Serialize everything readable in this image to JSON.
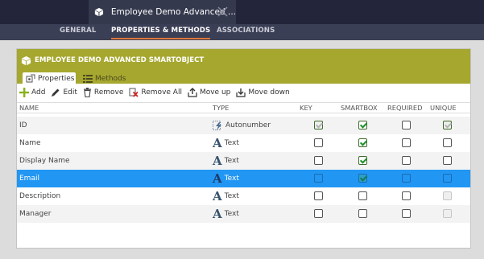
{
  "window": {
    "tab_title": "Employee Demo Advanced ...",
    "tab_icon": "cube-icon",
    "close_icon": "close-icon"
  },
  "nav": {
    "tabs": [
      {
        "label": "GENERAL",
        "active": false
      },
      {
        "label": "PROPERTIES & METHODS",
        "active": true
      },
      {
        "label": "ASSOCIATIONS",
        "active": false
      }
    ]
  },
  "panel": {
    "title": "EMPLOYEE DEMO ADVANCED SMARTOBJECT",
    "subtabs": [
      {
        "label": "Properties",
        "icon": "properties-icon",
        "active": true
      },
      {
        "label": "Methods",
        "icon": "methods-icon",
        "active": false
      }
    ],
    "toolbar": [
      {
        "label": "Add",
        "icon": "plus-icon"
      },
      {
        "label": "Edit",
        "icon": "pencil-icon"
      },
      {
        "label": "Remove",
        "icon": "trash-icon"
      },
      {
        "label": "Remove All",
        "icon": "remove-all-icon"
      },
      {
        "label": "Move up",
        "icon": "move-up-icon"
      },
      {
        "label": "Move down",
        "icon": "move-down-icon"
      }
    ],
    "columns": [
      "NAME",
      "TYPE",
      "KEY",
      "SMARTBOX",
      "REQUIRED",
      "UNIQUE"
    ],
    "rows": [
      {
        "name": "ID",
        "type": "Autonumber",
        "type_icon": "autonumber-icon",
        "key": true,
        "smartbox": true,
        "required": false,
        "unique": true,
        "key_disabled": true,
        "unique_disabled": true,
        "selected": false
      },
      {
        "name": "Name",
        "type": "Text",
        "type_icon": "text-type-icon",
        "key": false,
        "smartbox": true,
        "required": false,
        "unique": false,
        "key_disabled": false,
        "unique_disabled": false,
        "selected": false
      },
      {
        "name": "Display Name",
        "type": "Text",
        "type_icon": "text-type-icon",
        "key": false,
        "smartbox": true,
        "required": false,
        "unique": false,
        "key_disabled": false,
        "unique_disabled": false,
        "selected": false
      },
      {
        "name": "Email",
        "type": "Text",
        "type_icon": "text-type-icon",
        "key": false,
        "smartbox": true,
        "required": false,
        "unique": false,
        "key_disabled": false,
        "unique_disabled": false,
        "selected": true
      },
      {
        "name": "Description",
        "type": "Text",
        "type_icon": "text-type-icon",
        "key": false,
        "smartbox": false,
        "required": false,
        "unique": false,
        "key_disabled": false,
        "unique_disabled": true,
        "selected": false
      },
      {
        "name": "Manager",
        "type": "Text",
        "type_icon": "text-type-icon",
        "key": false,
        "smartbox": false,
        "required": false,
        "unique": false,
        "key_disabled": false,
        "unique_disabled": true,
        "selected": false
      }
    ]
  },
  "colors": {
    "topbar": "#23263a",
    "navbar": "#3b3f55",
    "accent": "#e0773a",
    "panel_header": "#a6a72f",
    "selected_row": "#2196f3"
  }
}
